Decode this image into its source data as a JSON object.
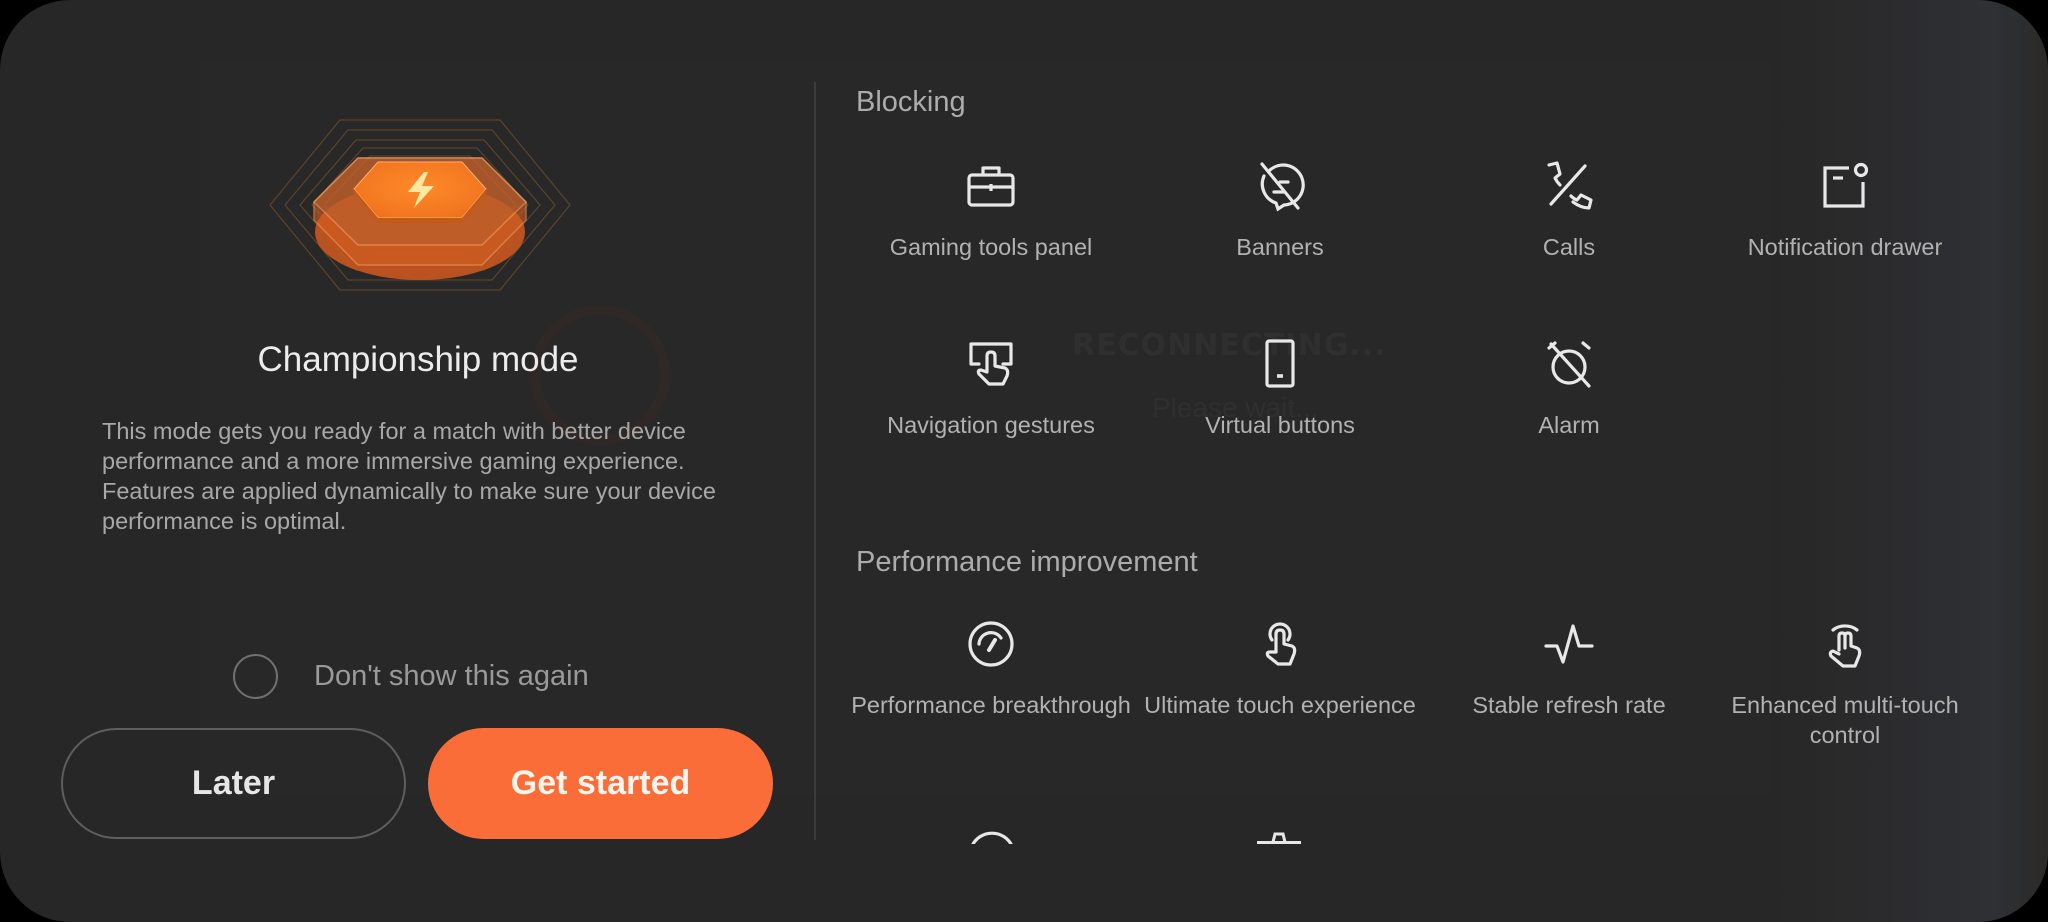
{
  "mode": {
    "title": "Championship mode",
    "description": "This mode gets you ready for a match with better device performance and a more immersive gaming experience. Features are applied dynamically to make sure your device performance is optimal.",
    "hero_icon": "lightning-hexagon-icon"
  },
  "checkbox": {
    "label": "Don't show this again",
    "checked": false
  },
  "buttons": {
    "later": "Later",
    "get_started": "Get started"
  },
  "colors": {
    "accent": "#fb6d38",
    "background": "#272727",
    "text_primary": "#ececec",
    "text_secondary": "#a8a8a8"
  },
  "overlay": {
    "title": "RECONNECTING...",
    "subtitle": "Please wait..."
  },
  "sections": [
    {
      "title": "Blocking",
      "items": [
        {
          "label": "Gaming tools panel",
          "icon": "toolbox-icon"
        },
        {
          "label": "Banners",
          "icon": "banner-off-icon"
        },
        {
          "label": "Calls",
          "icon": "call-off-icon"
        },
        {
          "label": "Notification drawer",
          "icon": "notification-drawer-icon"
        },
        {
          "label": "Navigation gestures",
          "icon": "gesture-icon"
        },
        {
          "label": "Virtual buttons",
          "icon": "phone-icon"
        },
        {
          "label": "Alarm",
          "icon": "alarm-off-icon"
        }
      ]
    },
    {
      "title": "Performance improvement",
      "items": [
        {
          "label": "Performance breakthrough",
          "icon": "speedometer-icon"
        },
        {
          "label": "Ultimate touch experience",
          "icon": "touch-icon"
        },
        {
          "label": "Stable refresh rate",
          "icon": "pulse-icon"
        },
        {
          "label": "Enhanced multi-touch control",
          "icon": "multi-touch-icon"
        }
      ]
    }
  ]
}
